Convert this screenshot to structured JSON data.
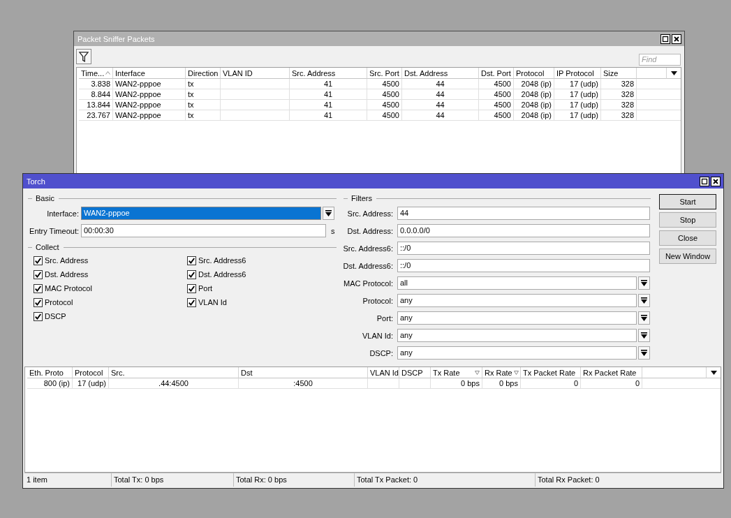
{
  "sniffer_window": {
    "title": "Packet Sniffer Packets",
    "active": false,
    "search": {
      "placeholder": "Find"
    },
    "table": {
      "columns": [
        {
          "label": "Time...",
          "sorted": true,
          "descending": false
        },
        {
          "label": "Interface",
          "sorted": false
        },
        {
          "label": "Direction",
          "sorted": false
        },
        {
          "label": "VLAN ID",
          "sorted": false
        },
        {
          "label": "Src. Address",
          "sorted": false
        },
        {
          "label": "Src. Port",
          "sorted": false
        },
        {
          "label": "Dst. Address",
          "sorted": false
        },
        {
          "label": "Dst. Port",
          "sorted": false
        },
        {
          "label": "Protocol",
          "sorted": false
        },
        {
          "label": "IP Protocol",
          "sorted": false
        },
        {
          "label": "Size",
          "sorted": false
        }
      ],
      "rows": [
        {
          "time": "3.838",
          "interface": "WAN2-pppoe",
          "direction": "tx",
          "src_address": "41",
          "src_port": "4500",
          "dst_address": "44",
          "dst_port": "4500",
          "protocol": "2048 (ip)",
          "ip_protocol": "17 (udp)",
          "size": "328"
        },
        {
          "time": "8.844",
          "interface": "WAN2-pppoe",
          "direction": "tx",
          "src_address": "41",
          "src_port": "4500",
          "dst_address": "44",
          "dst_port": "4500",
          "protocol": "2048 (ip)",
          "ip_protocol": "17 (udp)",
          "size": "328"
        },
        {
          "time": "13.844",
          "interface": "WAN2-pppoe",
          "direction": "tx",
          "src_address": "41",
          "src_port": "4500",
          "dst_address": "44",
          "dst_port": "4500",
          "protocol": "2048 (ip)",
          "ip_protocol": "17 (udp)",
          "size": "328"
        },
        {
          "time": "23.767",
          "interface": "WAN2-pppoe",
          "direction": "tx",
          "src_address": "41",
          "src_port": "4500",
          "dst_address": "44",
          "dst_port": "4500",
          "protocol": "2048 (ip)",
          "ip_protocol": "17 (udp)",
          "size": "328"
        }
      ]
    }
  },
  "torch_window": {
    "title": "Torch",
    "active": true,
    "basic": {
      "title": "Basic",
      "fields": [
        {
          "kind": "dropdown",
          "label": "Interface:",
          "value": "WAN2-pppoe",
          "text_selected": true
        },
        {
          "kind": "text",
          "label": "Entry Timeout:",
          "value": "00:00:30",
          "unit": "s",
          "text_selected": false
        }
      ]
    },
    "collect": {
      "title": "Collect",
      "options": [
        {
          "label": "Src. Address",
          "checked": true
        },
        {
          "label": "Src. Address6",
          "checked": true
        },
        {
          "label": "Dst. Address",
          "checked": true
        },
        {
          "label": "Dst. Address6",
          "checked": true
        },
        {
          "label": "MAC Protocol",
          "checked": true
        },
        {
          "label": "Port",
          "checked": true
        },
        {
          "label": "Protocol",
          "checked": true
        },
        {
          "label": "VLAN Id",
          "checked": true
        },
        {
          "label": "DSCP",
          "checked": true
        }
      ]
    },
    "filters": {
      "title": "Filters",
      "fields": [
        {
          "kind": "text",
          "label": "Src. Address:",
          "value": "44"
        },
        {
          "kind": "text",
          "label": "Dst. Address:",
          "value": "0.0.0.0/0"
        },
        {
          "kind": "text",
          "label": "Src. Address6:",
          "value": "::/0"
        },
        {
          "kind": "text",
          "label": "Dst. Address6:",
          "value": "::/0"
        },
        {
          "kind": "dropdown",
          "label": "MAC Protocol:",
          "value": "all"
        },
        {
          "kind": "dropdown",
          "label": "Protocol:",
          "value": "any"
        },
        {
          "kind": "dropdown",
          "label": "Port:",
          "value": "any"
        },
        {
          "kind": "dropdown",
          "label": "VLAN Id:",
          "value": "any"
        },
        {
          "kind": "dropdown",
          "label": "DSCP:",
          "value": "any"
        }
      ]
    },
    "buttons": [
      {
        "label": "Start",
        "default": true
      },
      {
        "label": "Stop",
        "default": false
      },
      {
        "label": "Close",
        "default": false
      },
      {
        "label": "New Window",
        "default": false
      }
    ],
    "table": {
      "columns": [
        {
          "label": "Eth. Proto",
          "sorted": false
        },
        {
          "label": "Protocol",
          "sorted": false
        },
        {
          "label": "Src.",
          "sorted": false
        },
        {
          "label": "Dst",
          "sorted": false
        },
        {
          "label": "VLAN Id",
          "sorted": false
        },
        {
          "label": "DSCP",
          "sorted": false
        },
        {
          "label": "Tx Rate",
          "sorted": true,
          "descending": true
        },
        {
          "label": "Rx Rate",
          "sorted": true,
          "descending": true
        },
        {
          "label": "Tx Packet Rate",
          "sorted": false
        },
        {
          "label": "Rx Packet Rate",
          "sorted": false
        }
      ],
      "rows": [
        {
          "eth_proto": "800 (ip)",
          "protocol": "17 (udp)",
          "src": ".44:4500",
          "dst": ":4500",
          "tx_rate": "0 bps",
          "rx_rate": "0 bps",
          "tx_packet_rate": "0",
          "rx_packet_rate": "0"
        }
      ]
    },
    "status_bar": [
      "1 item",
      "Total Tx: 0 bps",
      "Total Rx: 0 bps",
      "Total Tx Packet: 0",
      "Total Rx Packet: 0"
    ]
  }
}
